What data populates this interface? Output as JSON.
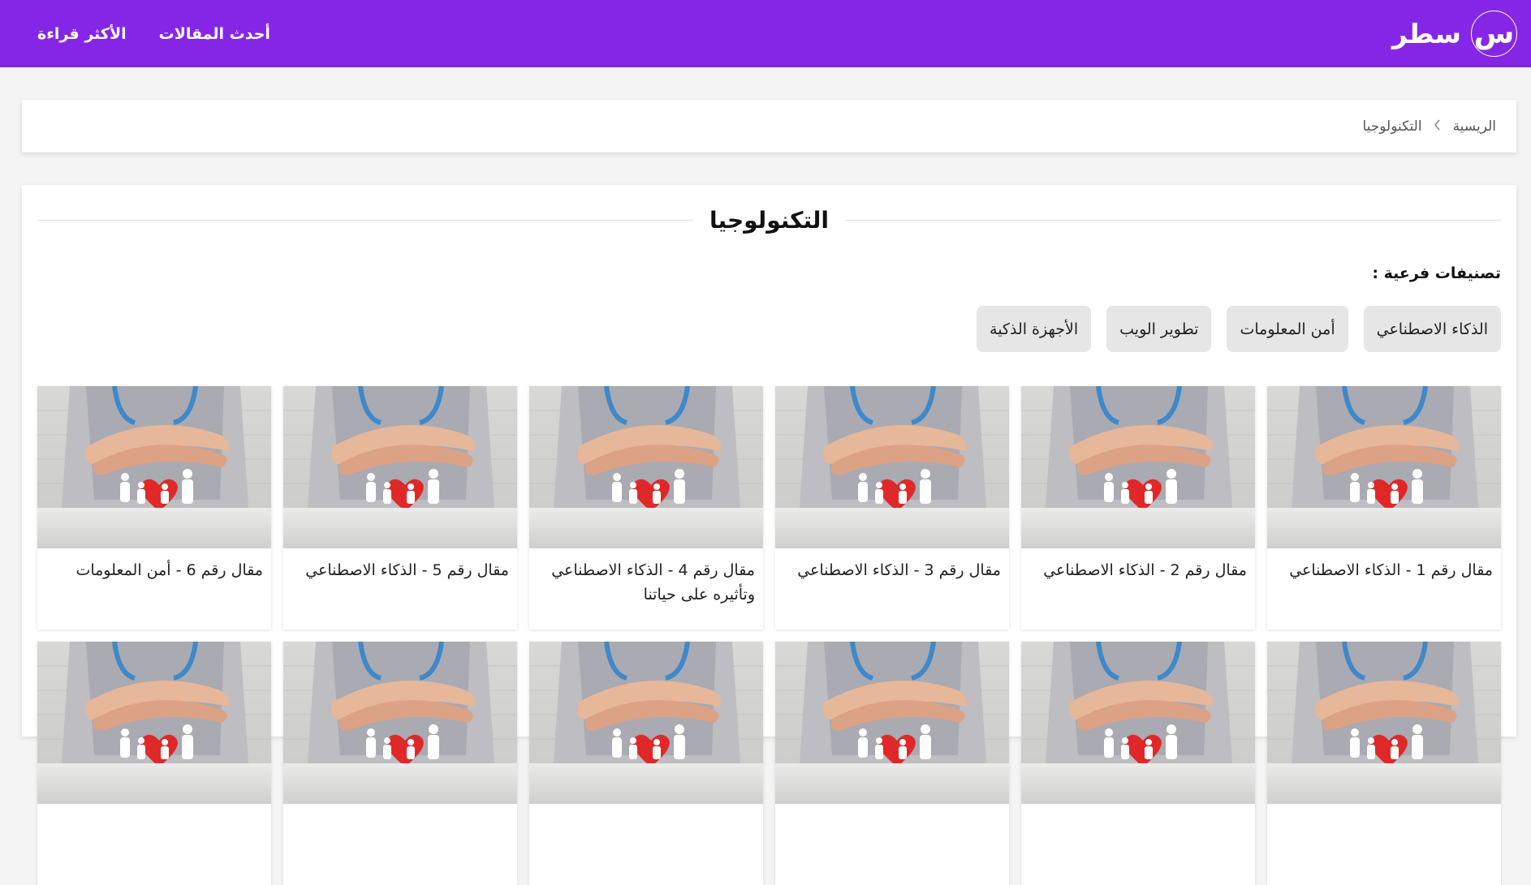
{
  "header": {
    "logo_glyph": "س",
    "brand": "سطر",
    "nav": [
      "أحدث المقالات",
      "الأكثر قراءة"
    ],
    "bg_color": "#8526e6"
  },
  "breadcrumb": {
    "items": [
      "الريسية",
      "التكنولوجيا"
    ],
    "separator_icon": "chevron-left-icon"
  },
  "section": {
    "title": "التكنولوجيا",
    "subcategories_heading": "تصنيفات فرعية :",
    "subcategories": [
      "الذكاء الاصطناعي",
      "أمن المعلومات",
      "تطوير الويب",
      "الأجهزة الذكية"
    ]
  },
  "articles": [
    {
      "title": "مقال رقم 1 - الذكاء الاصطناعي",
      "thumb": "hands-protecting-paper-family-heart"
    },
    {
      "title": "مقال رقم 2 - الذكاء الاصطناعي",
      "thumb": "hands-protecting-paper-family-heart"
    },
    {
      "title": "مقال رقم 3 - الذكاء الاصطناعي",
      "thumb": "hands-protecting-paper-family-heart"
    },
    {
      "title": "مقال رقم 4 - الذكاء الاصطناعي وتأثيره على حياتنا",
      "thumb": "hands-protecting-paper-family-heart"
    },
    {
      "title": "مقال رقم 5 - الذكاء الاصطناعي",
      "thumb": "hands-protecting-paper-family-heart"
    },
    {
      "title": "مقال رقم 6 - أمن المعلومات",
      "thumb": "hands-protecting-paper-family-heart"
    },
    {
      "title": "",
      "thumb": "hands-protecting-paper-family-heart"
    },
    {
      "title": "",
      "thumb": "hands-protecting-paper-family-heart"
    },
    {
      "title": "",
      "thumb": "hands-protecting-paper-family-heart"
    },
    {
      "title": "",
      "thumb": "hands-protecting-paper-family-heart"
    },
    {
      "title": "",
      "thumb": "hands-protecting-paper-family-heart"
    },
    {
      "title": "",
      "thumb": "hands-protecting-paper-family-heart"
    }
  ]
}
